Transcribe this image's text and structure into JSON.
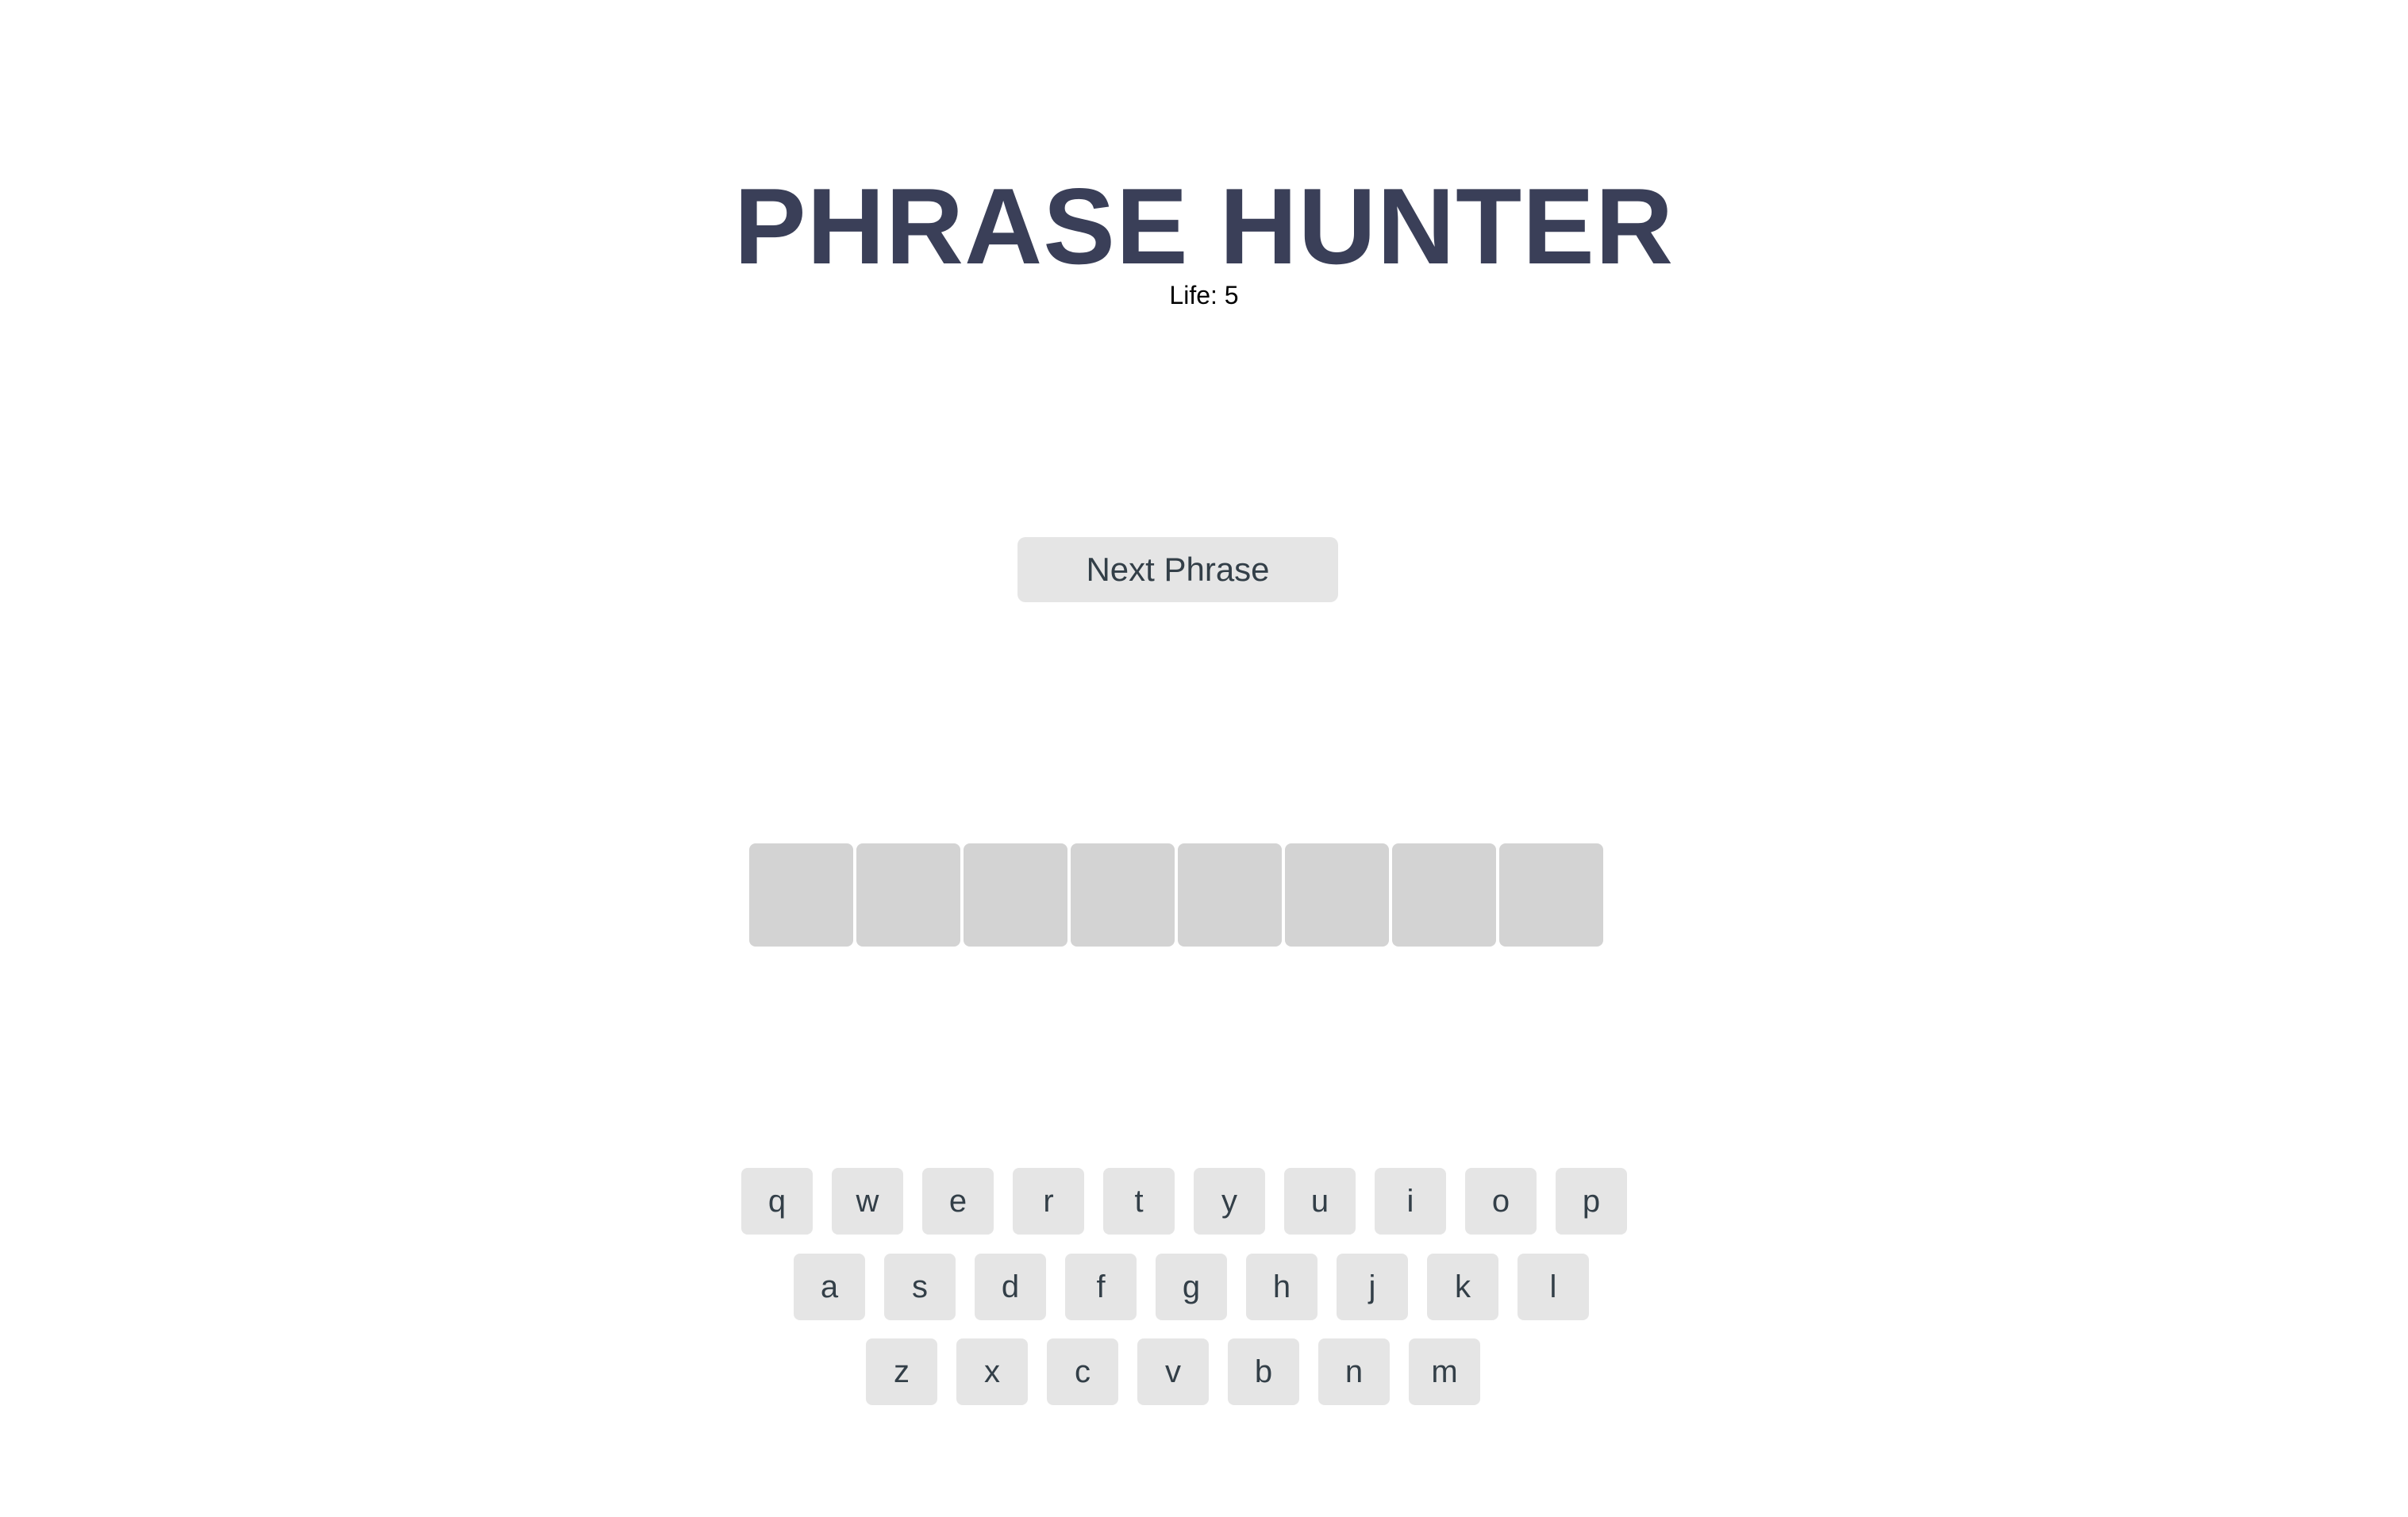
{
  "header": {
    "title": "PHRASE HUNTER",
    "life_label": "Life: 5"
  },
  "controls": {
    "next_phrase_label": "Next Phrase"
  },
  "phrase": {
    "tile_count": 8,
    "tiles": [
      "",
      "",
      "",
      "",
      "",
      "",
      "",
      ""
    ]
  },
  "keyboard": {
    "rows": [
      [
        "q",
        "w",
        "e",
        "r",
        "t",
        "y",
        "u",
        "i",
        "o",
        "p"
      ],
      [
        "a",
        "s",
        "d",
        "f",
        "g",
        "h",
        "j",
        "k",
        "l"
      ],
      [
        "z",
        "x",
        "c",
        "v",
        "b",
        "n",
        "m"
      ]
    ]
  },
  "colors": {
    "title": "#3a3f58",
    "key_bg": "#e5e5e5",
    "tile_bg": "#d3d3d3",
    "key_text": "#333f48"
  }
}
